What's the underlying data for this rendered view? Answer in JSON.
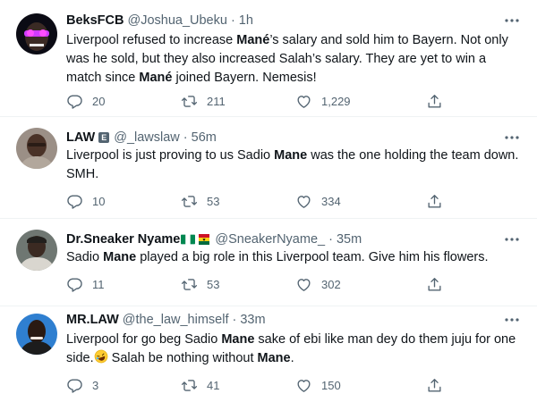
{
  "tweets": [
    {
      "name": "BeksFCB",
      "handle": "@Joshua_Ubeku",
      "time": "1h",
      "body": [
        "Liverpool refused to increase ",
        "Mané",
        "’s salary and sold him to Bayern. Not only was he sold, but they also increased Salah’s salary. They are yet to win a match since ",
        "Mané",
        " joined Bayern. Nemesis!"
      ],
      "replies": "20",
      "retweets": "211",
      "likes": "1,229"
    },
    {
      "name": "LAW",
      "badge": "E",
      "handle": "@_lawslaw",
      "time": "56m",
      "body": [
        "Liverpool is just proving to us Sadio ",
        "Mane",
        " was the one holding the team down. SMH."
      ],
      "replies": "10",
      "retweets": "53",
      "likes": "334"
    },
    {
      "name": "Dr.Sneaker Nyame",
      "handle": "@SneakerNyame_",
      "time": "35m",
      "flags": [
        "nigeria-flag",
        "ghana-flag"
      ],
      "body": [
        "Sadio ",
        "Mane",
        " played a big role in this Liverpool team. Give him his flowers."
      ],
      "replies": "11",
      "retweets": "53",
      "likes": "302"
    },
    {
      "name": "MR.LAW",
      "handle": "@the_law_himself",
      "time": "33m",
      "body": [
        "Liverpool for go beg Sadio ",
        "Mane",
        " sake of ebi like man dey do them juju for one side.",
        " Salah be nothing without ",
        "Mane",
        "."
      ],
      "replies": "3",
      "retweets": "41",
      "likes": "150"
    }
  ],
  "dot": "·",
  "icons": [
    "more-icon",
    "reply-icon",
    "retweet-icon",
    "like-icon",
    "share-icon",
    "rofl-emoji"
  ],
  "colors": {
    "text": "#0f1419",
    "secondary": "#536471",
    "divider": "#eff3f4"
  }
}
